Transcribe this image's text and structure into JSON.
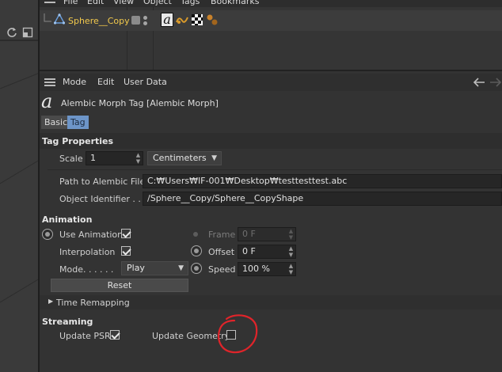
{
  "object_manager": {
    "menu": [
      "File",
      "Edit",
      "View",
      "Object",
      "Tags",
      "Bookmarks"
    ],
    "object_name": "Sphere__Copy",
    "tag_glyph": "a"
  },
  "attribute_manager": {
    "menu": [
      "Mode",
      "Edit",
      "User Data"
    ],
    "tag_glyph": "a",
    "title": "Alembic Morph Tag [Alembic Morph]",
    "tabs": [
      "Basic",
      "Tag"
    ],
    "active_tab": "Tag",
    "tag_properties": {
      "heading": "Tag Properties",
      "scale_label": "Scale",
      "scale_value": "1",
      "units_value": "Centimeters",
      "path_label": "Path to Alembic File",
      "path_value": "C:₩Users₩IF-001₩Desktop₩testtesttest.abc",
      "identifier_label": "Object Identifier . .",
      "identifier_value": "/Sphere__Copy/Sphere__CopyShape"
    },
    "animation": {
      "heading": "Animation",
      "use_animation_label": "Use Animation",
      "use_animation_checked": true,
      "interpolation_label": "Interpolation",
      "interpolation_checked": true,
      "mode_label": "Mode. . . . . .",
      "mode_value": "Play",
      "reset_label": "Reset",
      "frame_label": "Frame",
      "frame_value": "0 F",
      "offset_label": "Offset",
      "offset_value": "0 F",
      "speed_label": "Speed",
      "speed_value": "100 %"
    },
    "time_remapping": {
      "label": "Time Remapping"
    },
    "streaming": {
      "heading": "Streaming",
      "update_psr_label": "Update PSR",
      "update_psr_checked": true,
      "update_geometry_label": "Update Geometry",
      "update_geometry_checked": false
    }
  },
  "colors": {
    "object_name": "#f2c94c",
    "active_tab": "#6d95c8",
    "annotation_circle": "#e0242a"
  }
}
